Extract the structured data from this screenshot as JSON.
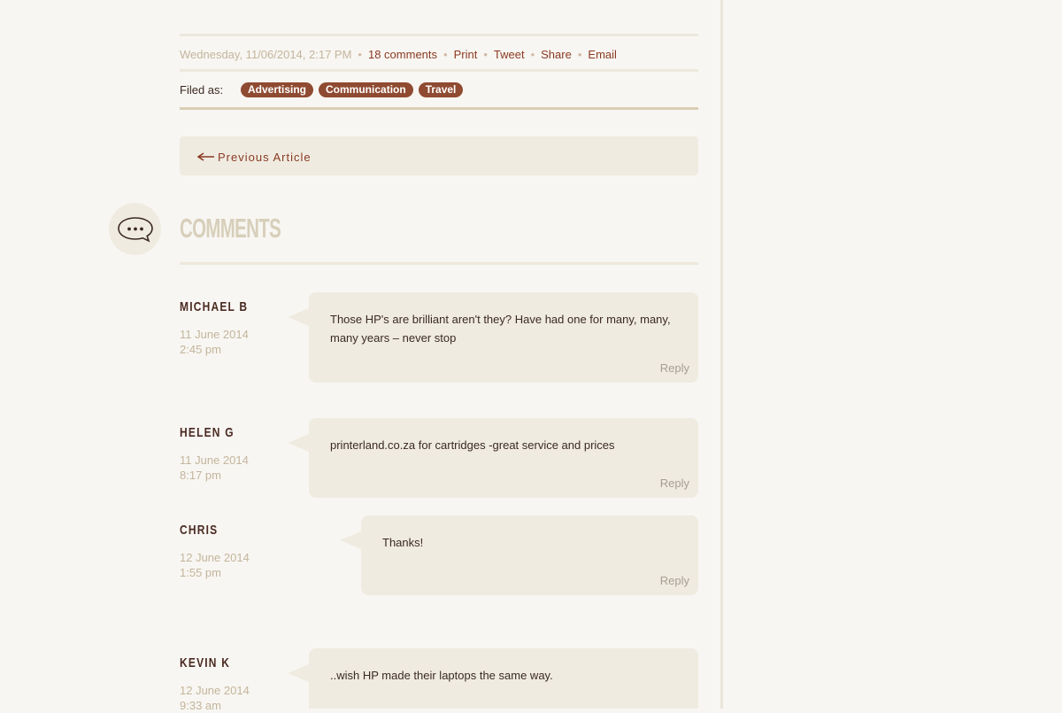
{
  "meta": {
    "date": "Wednesday, 11/06/2014, 2:17 PM",
    "links": [
      "18 comments",
      "Print",
      "Tweet",
      "Share",
      "Email"
    ],
    "separator": "•"
  },
  "filed": {
    "label": "Filed as:",
    "tags": [
      "Advertising",
      "Communication",
      "Travel"
    ]
  },
  "nav": {
    "previous_label": "Previous Article"
  },
  "comments": {
    "title": "Comments",
    "reply_label": "Reply",
    "items": [
      {
        "author": "Michael B",
        "date": "11 June 2014",
        "time": "2:45 pm",
        "text": "Those HP's are brilliant aren't they? Have had one for many, many, many years – never stop"
      },
      {
        "author": "Helen G",
        "date": "11 June 2014",
        "time": "8:17 pm",
        "text": "printerland.co.za for cartridges -great service and prices"
      },
      {
        "author": "Chris",
        "date": "12 June 2014",
        "time": "1:55 pm",
        "text": "Thanks!"
      },
      {
        "author": "Kevin K",
        "date": "12 June 2014",
        "time": "9:33 am",
        "text": "..wish HP made their laptops the same way."
      }
    ]
  },
  "colors": {
    "accent": "#8b3a22",
    "tag_bg": "#8f4b32",
    "muted": "#c3b59c",
    "panel": "#efebe1",
    "page_bg": "#f8f6f2"
  },
  "icons": [
    "arrow-left-icon",
    "speech-bubble-icon"
  ]
}
